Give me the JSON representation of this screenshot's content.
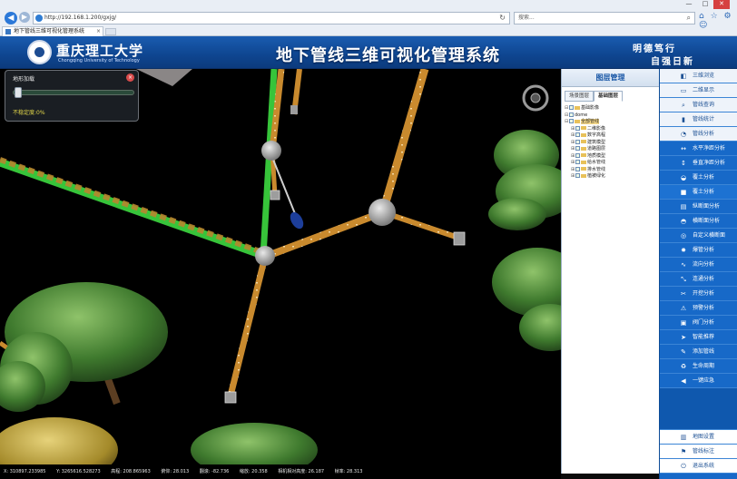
{
  "browser": {
    "url": "http://192.168.1.200/gxjg/",
    "search_placeholder": "搜索...",
    "tab_title": "地下管线三维可视化管理系统",
    "tools": "⌂ ☆ ⚙ ☺",
    "window_controls": {
      "minimize": "—",
      "maximize": "□",
      "close": "✕"
    }
  },
  "header": {
    "university": "重庆理工大学",
    "university_en": "Chongqing University of Technology",
    "title": "地下管线三维可视化管理系统",
    "motto_line1": "明德笃行",
    "motto_line2": "自强日新"
  },
  "progress_panel": {
    "title": "地形加载",
    "close": "×",
    "progress_percent": 0,
    "status": "不稳定度:0%"
  },
  "layer_panel": {
    "title": "图层管理",
    "tabs": [
      "场景图层",
      "基础图层"
    ],
    "active_tab": 1,
    "items": [
      {
        "label": "基础影像",
        "level": 0,
        "expand": "⊟",
        "folder": true,
        "selected": false
      },
      {
        "label": "dome",
        "level": 0,
        "expand": "⊟",
        "folder": false,
        "selected": false
      },
      {
        "label": "全部管线",
        "level": 0,
        "expand": "⊟",
        "folder": true,
        "selected": true
      },
      {
        "label": "二维影像",
        "level": 1,
        "expand": "⊞",
        "folder": true,
        "selected": false
      },
      {
        "label": "数字高程",
        "level": 1,
        "expand": "⊞",
        "folder": true,
        "selected": false
      },
      {
        "label": "建筑模型",
        "level": 1,
        "expand": "⊞",
        "folder": true,
        "selected": false
      },
      {
        "label": "道路图层",
        "level": 1,
        "expand": "⊞",
        "folder": true,
        "selected": false
      },
      {
        "label": "地质模型",
        "level": 1,
        "expand": "⊞",
        "folder": true,
        "selected": false
      },
      {
        "label": "给水管线",
        "level": 1,
        "expand": "⊞",
        "folder": true,
        "selected": false
      },
      {
        "label": "排水管线",
        "level": 1,
        "expand": "⊞",
        "folder": true,
        "selected": false
      },
      {
        "label": "植被绿化",
        "level": 1,
        "expand": "⊞",
        "folder": true,
        "selected": false
      }
    ]
  },
  "menu": {
    "items": [
      {
        "label": "三维浏览",
        "icon": "◧",
        "style": "sub"
      },
      {
        "label": "二维显示",
        "icon": "▭",
        "style": "sub"
      },
      {
        "label": "管线查询",
        "icon": "⌕",
        "style": "sub"
      },
      {
        "label": "管线统计",
        "icon": "▮",
        "style": "sub"
      },
      {
        "label": "管线分析",
        "icon": "◔",
        "style": "sub"
      },
      {
        "label": "水平净距分析",
        "icon": "↔",
        "style": "main"
      },
      {
        "label": "垂直净距分析",
        "icon": "↕",
        "style": "main"
      },
      {
        "label": "覆土分析",
        "icon": "◒",
        "style": "main"
      },
      {
        "label": "覆土分析",
        "icon": "■",
        "style": "alt"
      },
      {
        "label": "纵断面分析",
        "icon": "▤",
        "style": "main"
      },
      {
        "label": "横断面分析",
        "icon": "◓",
        "style": "main"
      },
      {
        "label": "自定义横断面",
        "icon": "◎",
        "style": "main"
      },
      {
        "label": "爆管分析",
        "icon": "✸",
        "style": "main"
      },
      {
        "label": "流向分析",
        "icon": "∿",
        "style": "main"
      },
      {
        "label": "连通分析",
        "icon": "⤡",
        "style": "main"
      },
      {
        "label": "开挖分析",
        "icon": "✂",
        "style": "main"
      },
      {
        "label": "预警分析",
        "icon": "⚠",
        "style": "main"
      },
      {
        "label": "阀门分析",
        "icon": "▣",
        "style": "main"
      },
      {
        "label": "智能推荐",
        "icon": "➤",
        "style": "main"
      },
      {
        "label": "添加管线",
        "icon": "✎",
        "style": "main"
      },
      {
        "label": "生命周期",
        "icon": "♻",
        "style": "main"
      },
      {
        "label": "一键应急",
        "icon": "◀",
        "style": "main"
      }
    ],
    "footer": [
      {
        "label": "地图设置",
        "icon": "▥"
      },
      {
        "label": "管线标注",
        "icon": "⚑"
      },
      {
        "label": "退出系统",
        "icon": "⏻"
      }
    ]
  },
  "status_bar": {
    "x": "X: 310897.233985",
    "y": "Y: 3265616.528273",
    "elevation": "高程: 208.865963",
    "heading": "俯仰: 28.013",
    "tilt": "翻滚: -82.736",
    "zoom": "缩放: 20.358",
    "altitude": "相机相对高度: 26.187",
    "scale": "帧率: 28.313"
  }
}
